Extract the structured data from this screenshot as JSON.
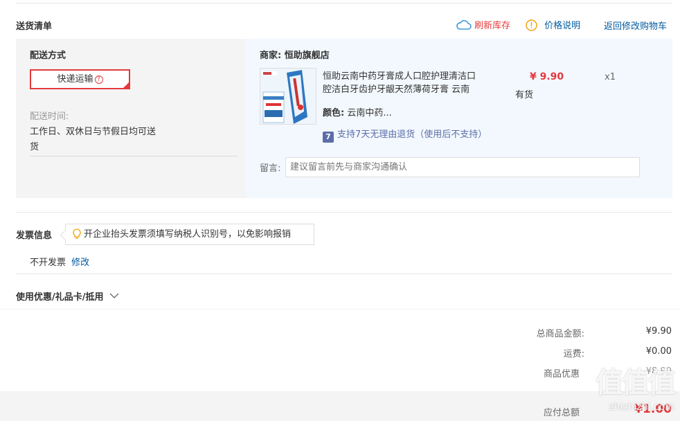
{
  "delivery": {
    "title": "送货清单",
    "refresh_label": "刷新库存",
    "price_note_label": "价格说明",
    "return_cart_label": "返回修改购物车",
    "shipping": {
      "heading": "配送方式",
      "selected": "快递运输",
      "time_label": "配送时间:",
      "time_value_line1": "工作日、双休日与节假日均可送",
      "time_value_line2": "货"
    },
    "store": {
      "label": "商家:",
      "name": "恒助旗舰店"
    },
    "product": {
      "name_line1": "恒助云南中药牙膏成人口腔护理清洁口",
      "name_line2": "腔洁白牙齿护牙龈天然薄荷牙膏 云南",
      "color_label": "颜色:",
      "color_value": "云南中药...",
      "price": "¥ 9.90",
      "stock": "有货",
      "quantity": "x1",
      "return_policy_badge": "7",
      "return_policy": "支持7天无理由退货（使用后不支持）"
    },
    "message": {
      "label": "留言:",
      "placeholder": "建议留言前先与商家沟通确认"
    }
  },
  "invoice": {
    "title": "发票信息",
    "tip": "开企业抬头发票须填写纳税人识别号，以免影响报销",
    "value": "不开发票",
    "edit_label": "修改"
  },
  "coupon": {
    "title": "使用优惠/礼品卡/抵用"
  },
  "summary": {
    "goods_total_label": "总商品金额:",
    "goods_total_value": "¥9.90",
    "shipping_label": "运费:",
    "shipping_value": "¥0.00",
    "discount_label": "商品优惠",
    "discount_value": "-¥8.90",
    "payable_label": "应付总额",
    "payable_value": "¥1.00"
  },
  "watermark": {
    "text": "值值值",
    "url": "zhizhizhi.com"
  },
  "colors": {
    "accent_red": "#e4393c",
    "link_blue": "#005aa0",
    "panel_blue": "#f3f8fe",
    "panel_gray": "#f4f4f4"
  }
}
